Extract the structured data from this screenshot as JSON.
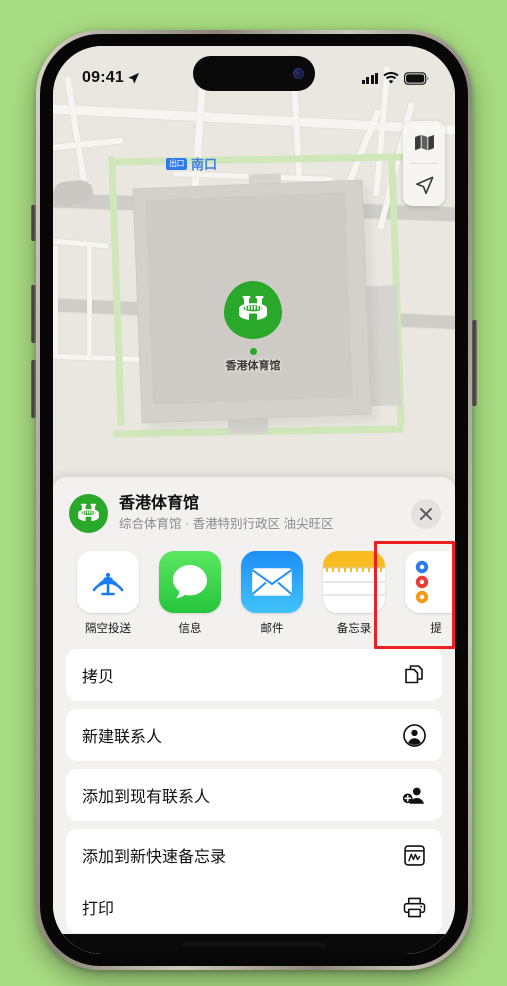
{
  "status_bar": {
    "time": "09:41",
    "location_icon": "location-arrow-icon",
    "signal_icon": "cellular-signal-icon",
    "wifi_icon": "wifi-icon",
    "battery_icon": "battery-icon"
  },
  "map": {
    "exit_badge": "出口",
    "exit_label": "南口",
    "pin_label": "香港体育馆",
    "pin_icon": "stadium-icon",
    "controls": {
      "layers_icon": "map-layers-icon",
      "locate_icon": "navigation-arrow-icon"
    }
  },
  "share_sheet": {
    "place_icon": "stadium-icon",
    "title": "香港体育馆",
    "subtitle": "综合体育馆 · 香港特别行政区 油尖旺区",
    "close_icon": "close-icon",
    "apps": [
      {
        "label": "隔空投送",
        "icon": "airdrop-icon"
      },
      {
        "label": "信息",
        "icon": "messages-icon"
      },
      {
        "label": "邮件",
        "icon": "mail-icon"
      },
      {
        "label": "备忘录",
        "icon": "notes-icon"
      },
      {
        "label": "提",
        "icon": "reminders-icon"
      }
    ],
    "highlighted_app": "备忘录",
    "highlight_color": "#ec2024",
    "actions": [
      {
        "label": "拷贝",
        "icon": "copy-icon"
      },
      {
        "label": "新建联系人",
        "icon": "person-circle-icon"
      },
      {
        "label": "添加到现有联系人",
        "icon": "person-badge-plus-icon"
      },
      {
        "label": "添加到新快速备忘录",
        "icon": "quick-note-icon"
      },
      {
        "label": "打印",
        "icon": "printer-icon"
      }
    ]
  },
  "colors": {
    "background": "#a8dc82",
    "accent_green": "#2aa82a",
    "highlight_red": "#ec2024",
    "transit_blue": "#2f7bea"
  }
}
